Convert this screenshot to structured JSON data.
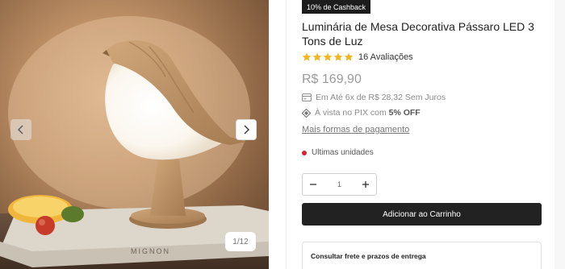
{
  "gallery": {
    "counter": "1/12",
    "photo_text": "MIGNON",
    "prev_icon": "chevron-left-icon",
    "next_icon": "chevron-right-icon"
  },
  "product": {
    "badge": "10% de Cashback",
    "title": "Luminária de Mesa Decorativa Pássaro LED 3 Tons de Luz",
    "rating": 5,
    "reviews": "16 Avaliações",
    "price": "R$ 169,90",
    "installments": "Em Até 6x de R$ 28,32 Sem Juros",
    "pix_prefix": "À vista no PIX com",
    "pix_discount": "5% OFF",
    "more_payments": "Mais formas de pagamento",
    "stock_status": "Ultimas unidades"
  },
  "purchase": {
    "quantity": "1",
    "add_to_cart": "Adicionar ao Carrinho",
    "shipping_label": "Consultar frete e prazos de entrega"
  },
  "colors": {
    "star": "#f2b51d",
    "button": "#222222",
    "stock_dot": "#d9232d",
    "badge": "#1c1c1c"
  }
}
